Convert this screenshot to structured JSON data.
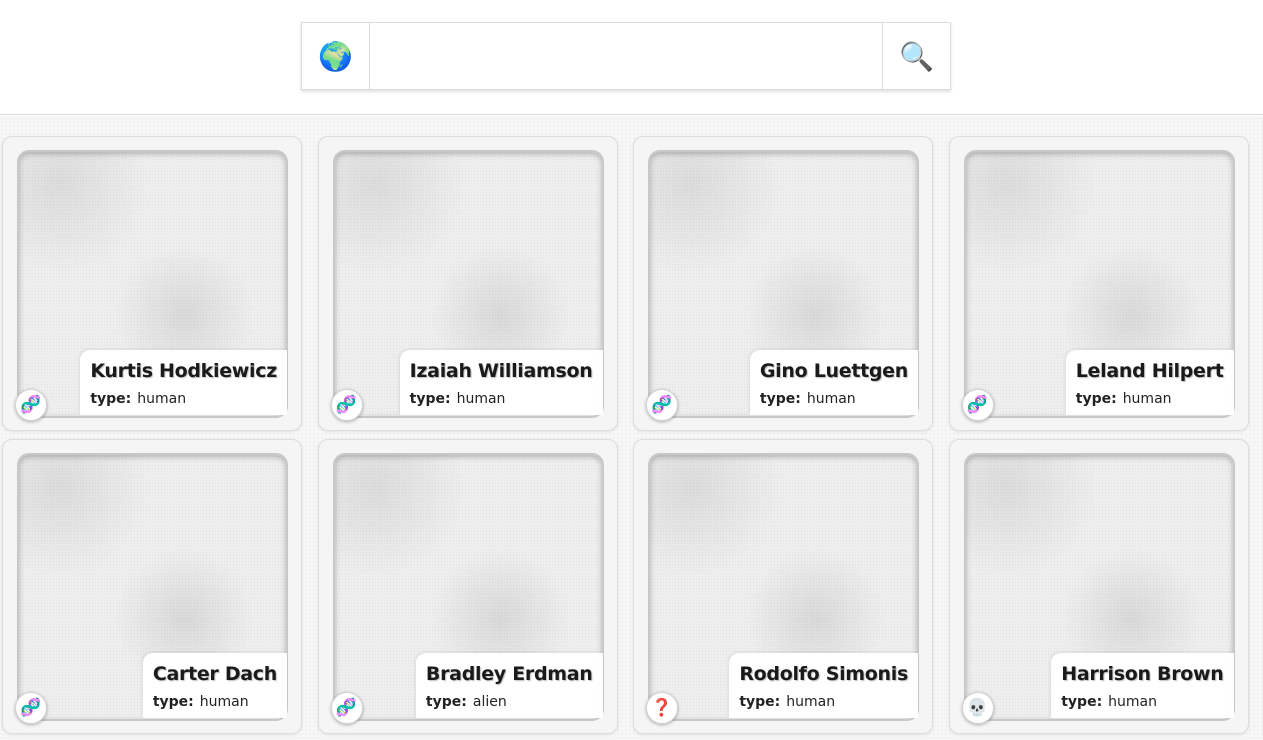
{
  "search": {
    "globe_icon": "🌍",
    "search_icon": "🔍",
    "query": "",
    "placeholder": ""
  },
  "cards": [
    {
      "name": "Kurtis Hodkiewicz",
      "type_label": "type:",
      "type_value": "human",
      "status_icon": "🧬",
      "status_name": "dna-icon"
    },
    {
      "name": "Izaiah Williamson",
      "type_label": "type:",
      "type_value": "human",
      "status_icon": "🧬",
      "status_name": "dna-icon"
    },
    {
      "name": "Gino Luettgen",
      "type_label": "type:",
      "type_value": "human",
      "status_icon": "🧬",
      "status_name": "dna-icon"
    },
    {
      "name": "Leland Hilpert",
      "type_label": "type:",
      "type_value": "human",
      "status_icon": "🧬",
      "status_name": "dna-icon"
    },
    {
      "name": "Carter Dach",
      "type_label": "type:",
      "type_value": "human",
      "status_icon": "🧬",
      "status_name": "dna-icon"
    },
    {
      "name": "Bradley Erdman",
      "type_label": "type:",
      "type_value": "alien",
      "status_icon": "🧬",
      "status_name": "dna-icon"
    },
    {
      "name": "Rodolfo Simonis",
      "type_label": "type:",
      "type_value": "human",
      "status_icon": "❓",
      "status_name": "question-mark-icon"
    },
    {
      "name": "Harrison Brown",
      "type_label": "type:",
      "type_value": "human",
      "status_icon": "💀",
      "status_name": "skull-icon"
    }
  ]
}
